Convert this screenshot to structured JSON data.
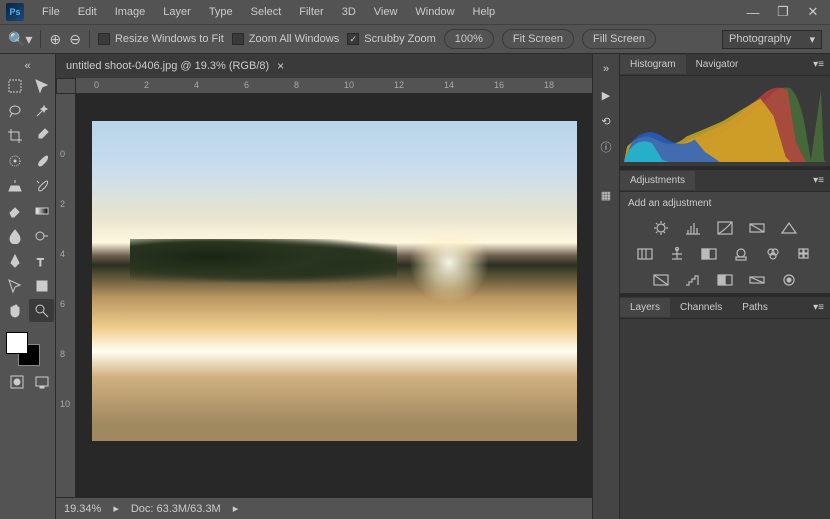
{
  "app": {
    "logo_text": "Ps"
  },
  "menu": [
    "File",
    "Edit",
    "Image",
    "Layer",
    "Type",
    "Select",
    "Filter",
    "3D",
    "View",
    "Window",
    "Help"
  ],
  "options_bar": {
    "resize_windows": "Resize Windows to Fit",
    "zoom_all": "Zoom All Windows",
    "scrubby": "Scrubby Zoom",
    "scrubby_checked": true,
    "zoom_pct": "100%",
    "fit": "Fit Screen",
    "fill": "Fill Screen"
  },
  "workspace": {
    "selected": "Photography"
  },
  "document": {
    "tab_title": "untitled shoot-0406.jpg @ 19.3% (RGB/8)",
    "zoom_status": "19.34%",
    "doc_size": "Doc: 63.3M/63.3M"
  },
  "ruler": {
    "h_ticks": [
      "0",
      "2",
      "4",
      "6",
      "8",
      "10",
      "12",
      "14",
      "16",
      "18"
    ],
    "v_ticks": [
      "0",
      "2",
      "4",
      "6",
      "8",
      "10"
    ]
  },
  "panels": {
    "histogram_tab": "Histogram",
    "navigator_tab": "Navigator",
    "adjustments_tab": "Adjustments",
    "add_adjustment": "Add an adjustment",
    "layers_tab": "Layers",
    "channels_tab": "Channels",
    "paths_tab": "Paths"
  },
  "colors": {
    "foreground": "#ffffff",
    "background": "#000000"
  }
}
